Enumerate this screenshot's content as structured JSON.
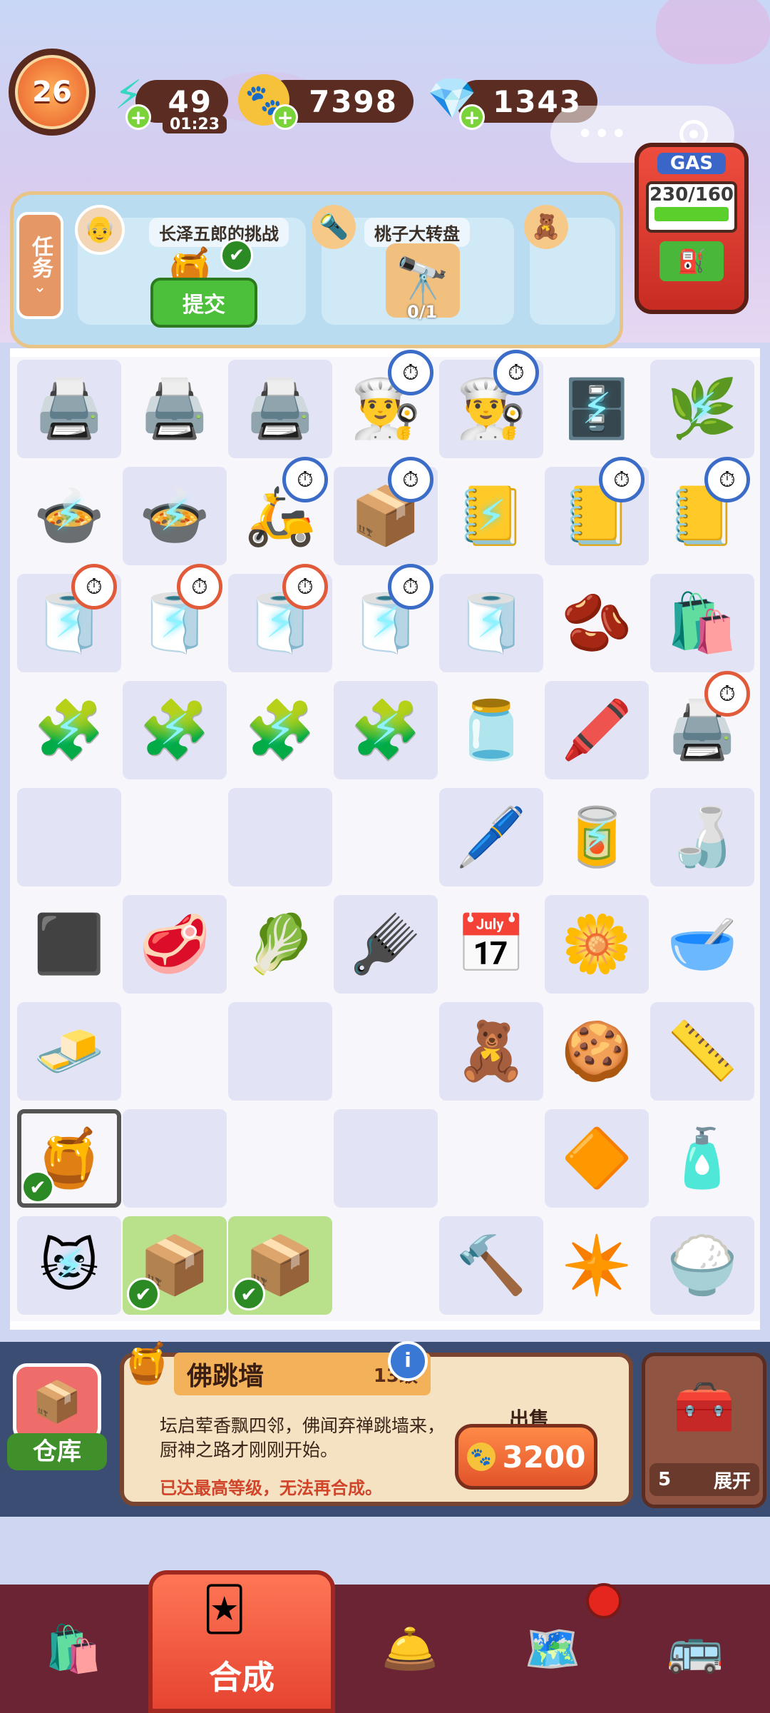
{
  "hud": {
    "level": "26",
    "energy": "49",
    "energy_timer": "01:23",
    "coins": "7398",
    "gems": "1343",
    "gas": "230/160",
    "gas_label": "GAS"
  },
  "quest": {
    "tab_label": "任务",
    "cards": [
      {
        "title": "长泽五郎的挑战",
        "button": "提交"
      },
      {
        "title": "桃子大转盘",
        "progress": "0/1"
      }
    ]
  },
  "board": {
    "cells": [
      [
        "🖨️",
        "🖨️",
        "🖨️",
        "👨‍🍳",
        "👨‍🍳",
        "🗄️",
        "🌿"
      ],
      [
        "🍲",
        "🍲",
        "🛵",
        "📦",
        "📒",
        "📒",
        "📒"
      ],
      [
        "🧻",
        "🧻",
        "🧻",
        "🧻",
        "🧻",
        "🫘",
        "🛍️"
      ],
      [
        "🧩",
        "🧩",
        "🧩",
        "🧩",
        "🫙",
        "🖍️",
        "🖨️"
      ],
      [
        "",
        "",
        "",
        "",
        "🖊️",
        "🥫",
        "🍶"
      ],
      [
        "⬛",
        "🥩",
        "🥬",
        "🪮",
        "📅",
        "🌼",
        "🥣"
      ],
      [
        "🧈",
        "",
        "",
        "",
        "🧸",
        "🍪",
        "📏"
      ],
      [
        "🍯",
        "",
        "",
        "",
        "",
        "🔶",
        "🧴"
      ],
      [
        "🐱",
        "📦",
        "📦",
        "",
        "🔨",
        "✴️",
        "🍚"
      ]
    ]
  },
  "selected_item": {
    "name": "佛跳墙",
    "level": "13级",
    "desc": "坛启荤香飘四邻，佛闻弃禅跳墙来，厨神之路才刚刚开始。",
    "note": "已达最高等级，无法再合成。",
    "sell_label": "出售",
    "sell_price": "3200"
  },
  "warehouse_label": "仓库",
  "expand": {
    "count": "5",
    "label": "展开"
  },
  "nav": {
    "merge_label": "合成"
  },
  "colors": {
    "accent": "#e64431",
    "panel": "#f4e2c3",
    "board": "#f7f6fb"
  }
}
